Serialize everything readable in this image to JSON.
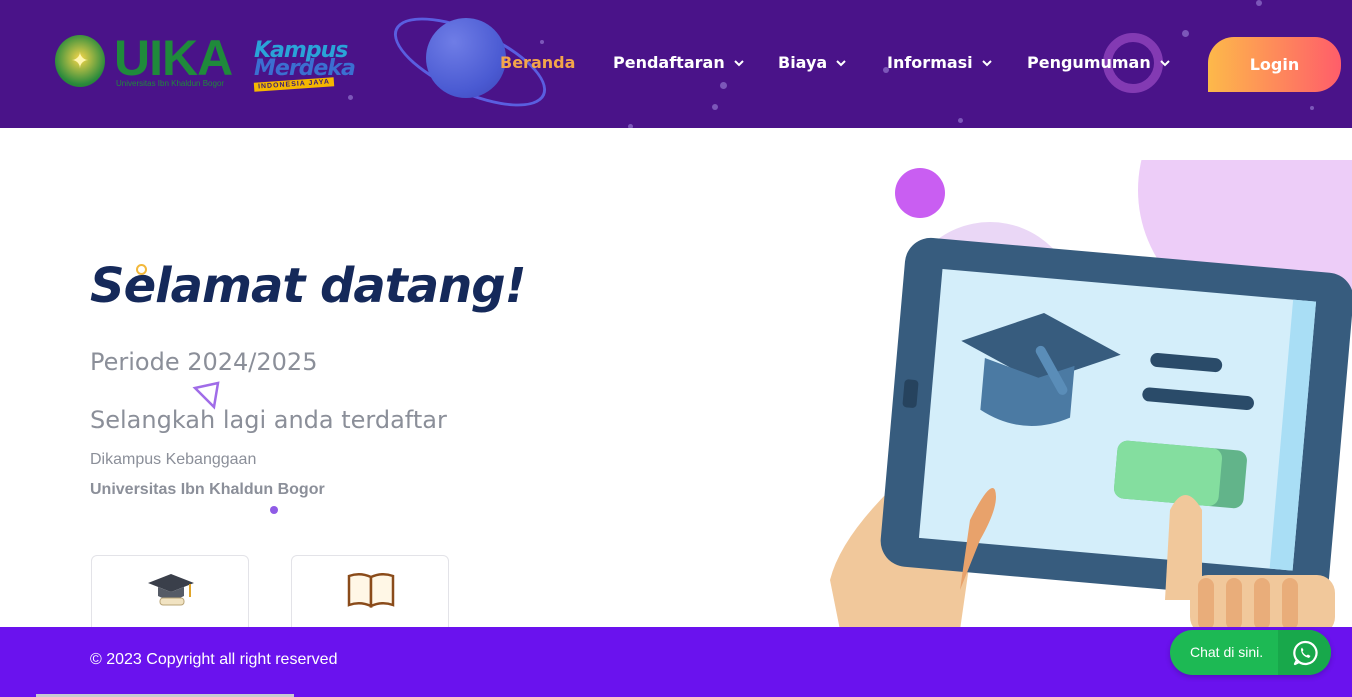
{
  "header": {
    "logo_uika": {
      "word": "UIKA",
      "subtitle": "Universitas Ibn Khaldun Bogor",
      "color": "#1f8a3b"
    },
    "logo_kampus_merdeka": {
      "line1": "Kampus",
      "line2": "Merdeka",
      "tag": "INDONESIA JAYA"
    },
    "nav": [
      {
        "label": "Beranda",
        "active": true,
        "dropdown": false
      },
      {
        "label": "Pendaftaran",
        "active": false,
        "dropdown": true
      },
      {
        "label": "Biaya",
        "active": false,
        "dropdown": true
      },
      {
        "label": "Informasi",
        "active": false,
        "dropdown": true
      },
      {
        "label": "Pengumuman",
        "active": false,
        "dropdown": true
      }
    ],
    "login_label": "Login",
    "colors": {
      "background": "#4a1389",
      "active": "#f3a54a"
    }
  },
  "hero": {
    "title": "Selamat datang!",
    "period": "Periode 2024/2025",
    "subtitle": "Selangkah lagi anda terdaftar",
    "small": "Dikampus Kebanggaan",
    "university": "Universitas Ibn Khaldun Bogor",
    "cards": [
      {
        "icon": "graduation-cap-icon"
      },
      {
        "icon": "open-book-icon"
      }
    ]
  },
  "footer": {
    "copyright": "© 2023 Copyright all right reserved",
    "chat_label": "Chat di sini.",
    "chat_icon": "whatsapp-icon",
    "colors": {
      "background": "#6a12ee",
      "chat": "#1db954"
    }
  }
}
